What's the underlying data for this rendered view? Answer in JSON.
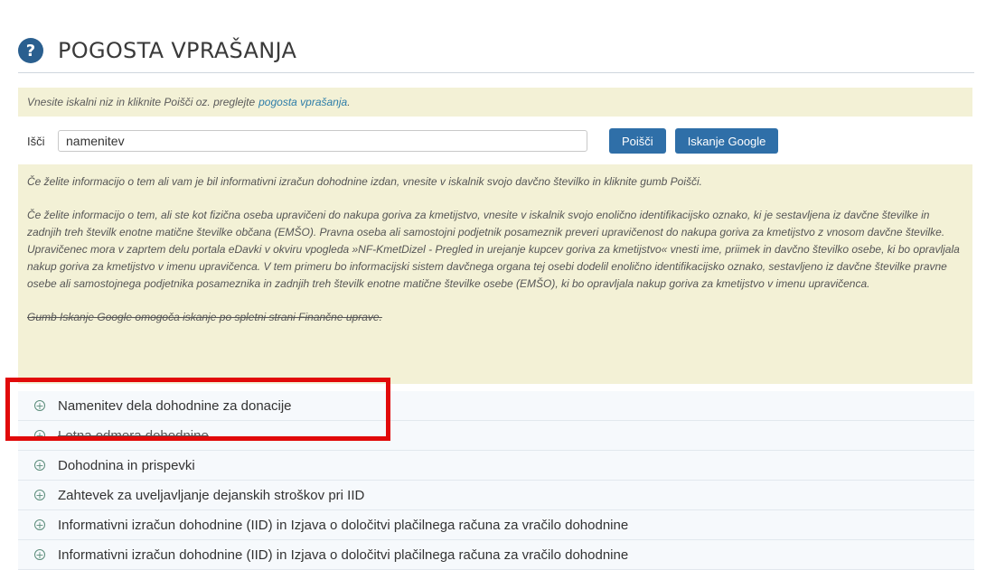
{
  "header": {
    "title": "POGOSTA VPRAŠANJA",
    "icon_text": "?"
  },
  "hint": {
    "text": "Vnesite iskalni niz in kliknite Poišči oz. preglejte",
    "link": "pogosta vprašanja",
    "suffix": "."
  },
  "search": {
    "label": "Išči",
    "value": "namenitev",
    "search_button": "Poišči",
    "google_button": "Iskanje Google"
  },
  "info": {
    "p1": "Če želite informacijo o tem ali vam je bil informativni izračun dohodnine izdan, vnesite v iskalnik svojo davčno številko in kliknite gumb Poišči.",
    "p2": "Če želite informacijo o tem, ali ste kot fizična oseba upravičeni do nakupa goriva za kmetijstvo, vnesite v iskalnik svojo enolično identifikacijsko oznako, ki je sestavljena iz davčne številke in zadnjih treh številk enotne matične številke občana (EMŠO). Pravna oseba ali samostojni podjetnik posameznik preveri upravičenost do nakupa goriva za kmetijstvo z vnosom davčne številke. Upravičenec mora v zaprtem delu portala eDavki v okviru vpogleda »NF-KmetDizel - Pregled in urejanje kupcev goriva za kmetijstvo« vnesti ime, priimek in davčno številko osebe, ki bo opravljala nakup goriva za kmetijstvo v imenu upravičenca. V tem primeru bo informacijski sistem davčnega organa tej osebi dodelil enolično identifikacijsko oznako, sestavljeno iz davčne številke pravne osebe ali samostojnega podjetnika posameznika in zadnjih treh številk enotne matične številke osebe (EMŠO), ki bo opravljala nakup goriva za kmetijstvo v imenu upravičenca.",
    "p3": "Gumb Iskanje Google omogoča iskanje po spletni strani Finančne uprave."
  },
  "faq": {
    "items": [
      "Namenitev dela dohodnine za donacije",
      "Letna odmera dohodnine",
      "Dohodnina in prispevki",
      "Zahtevek za uveljavljanje dejanskih stroškov pri IID",
      "Informativni izračun dohodnine (IID) in Izjava o določitvi plačilnega računa za vračilo dohodnine",
      "Informativni izračun dohodnine (IID) in Izjava o določitvi plačilnega računa za vračilo dohodnine"
    ]
  },
  "colors": {
    "accent": "#2f6fa8",
    "note_background": "#f3f1d6",
    "highlight": "#e10a0a"
  }
}
